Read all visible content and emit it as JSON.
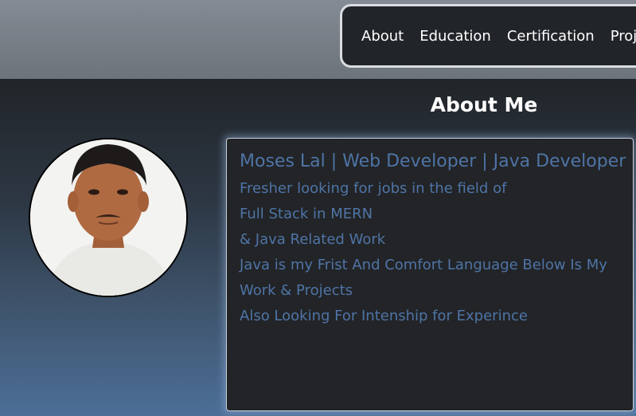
{
  "nav": {
    "items": [
      "About",
      "Education",
      "Certification",
      "Projects"
    ]
  },
  "about": {
    "title": "About Me",
    "heading": "Moses Lal | Web Developer | Java Developer",
    "lines": [
      "Fresher looking for jobs in the field of",
      "Full Stack in MERN",
      "& Java Related Work",
      "Java is my Frist And Comfort Language Below Is My Work & Projects",
      "Also Looking For Intenship for Experince"
    ]
  },
  "colors": {
    "accent_text": "#4f74a6",
    "card_bg": "#222427",
    "navbar_bg": "#212529"
  }
}
